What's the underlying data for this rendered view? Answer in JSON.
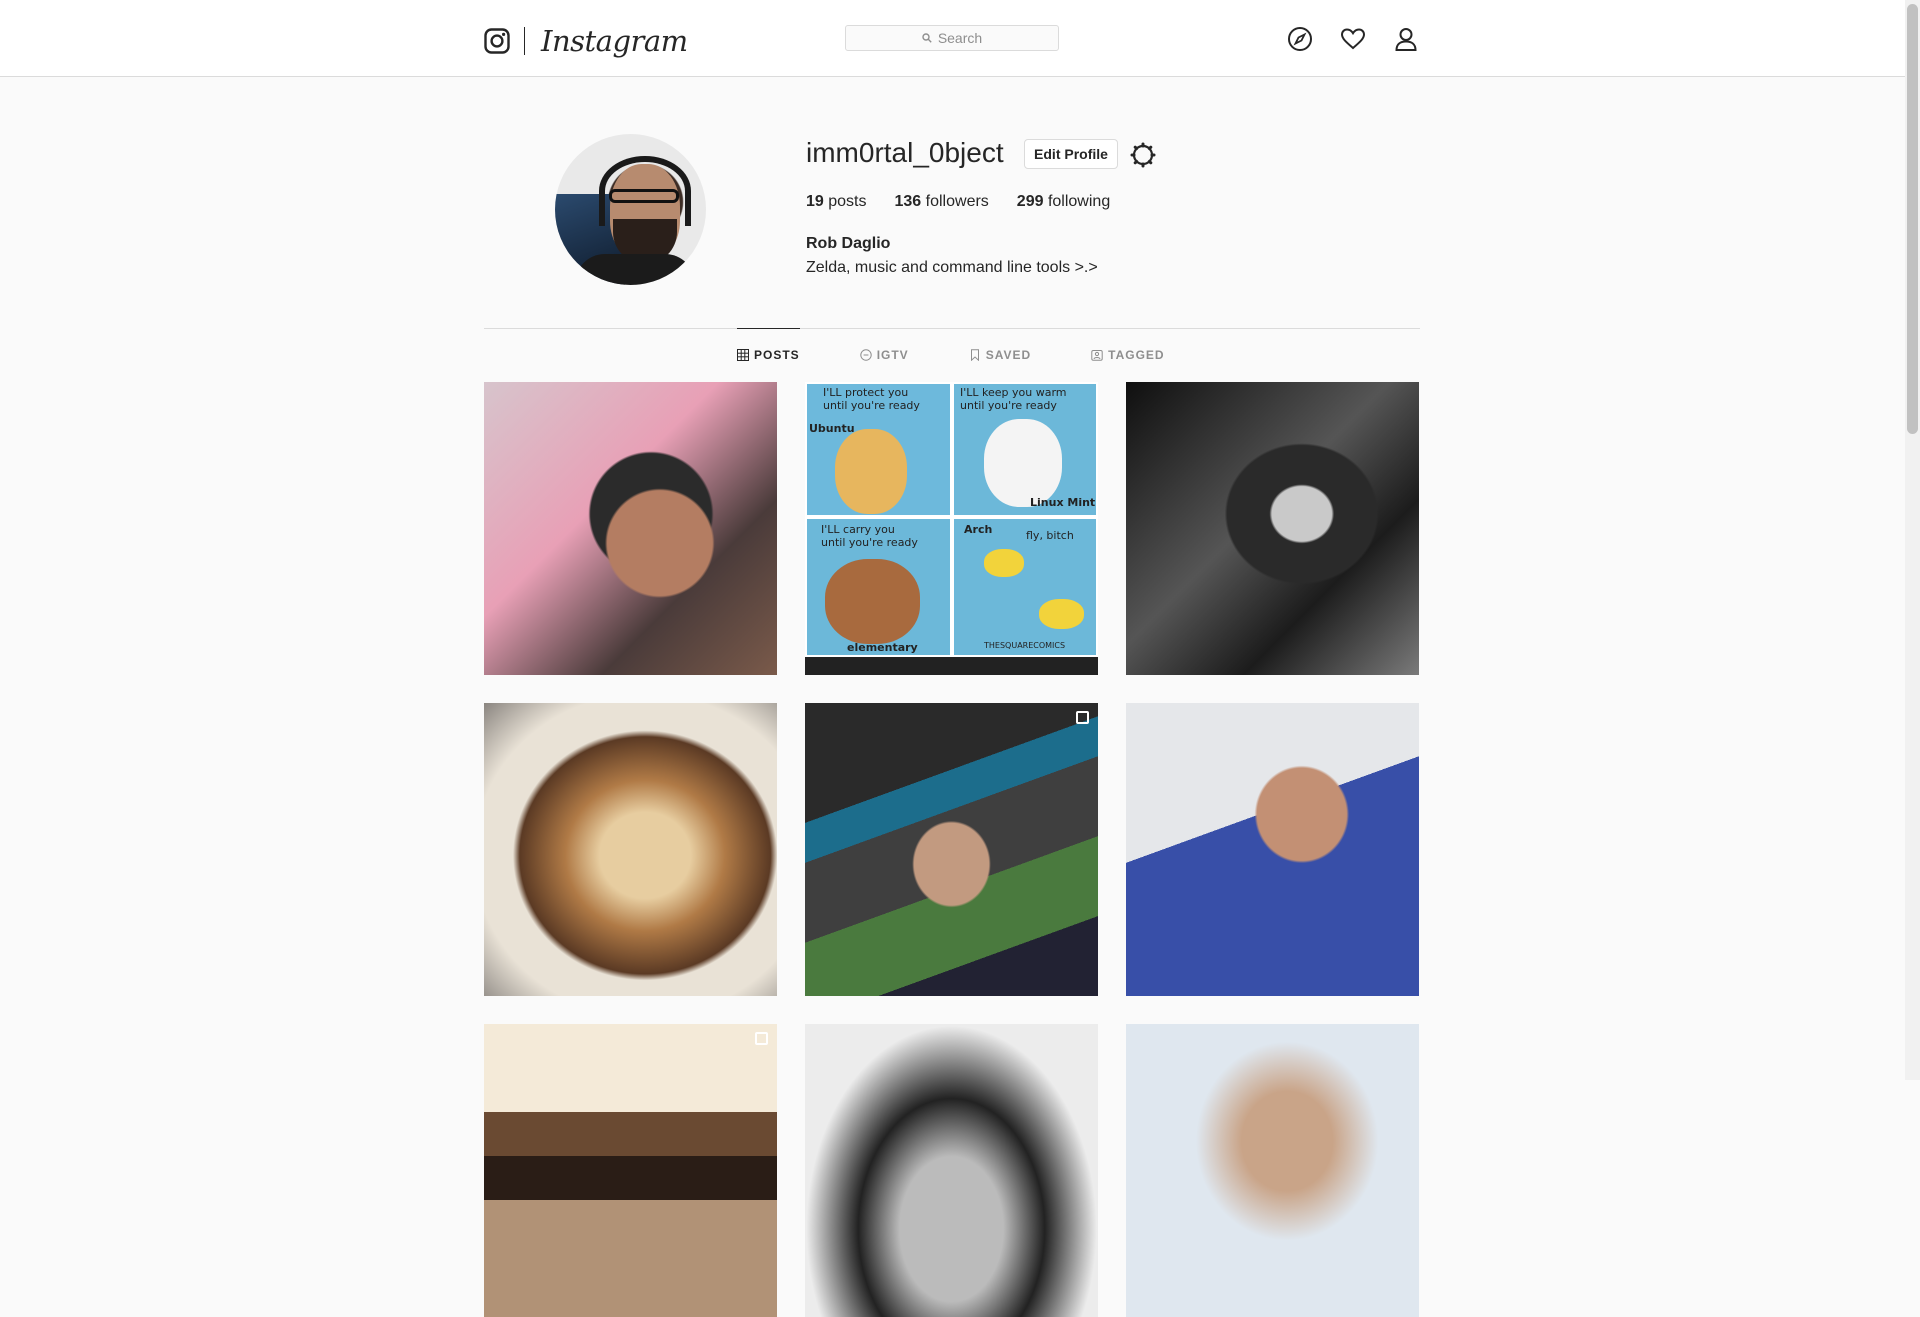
{
  "header": {
    "wordmark": "Instagram",
    "search_placeholder": "Search",
    "icons": [
      "instagram-glyph-icon",
      "search-icon",
      "compass-icon",
      "heart-icon",
      "user-icon"
    ]
  },
  "profile": {
    "username": "imm0rtal_0bject",
    "edit_profile_label": "Edit Profile",
    "stats": {
      "posts_count": "19",
      "posts_label": "posts",
      "followers_count": "136",
      "followers_label": "followers",
      "following_count": "299",
      "following_label": "following"
    },
    "full_name": "Rob Daglio",
    "bio": "Zelda, music and command line tools >.>"
  },
  "tabs": [
    {
      "label": "POSTS",
      "icon": "grid-icon",
      "active": true
    },
    {
      "label": "IGTV",
      "icon": "tv-icon",
      "active": false
    },
    {
      "label": "SAVED",
      "icon": "bookmark-icon",
      "active": false
    },
    {
      "label": "TAGGED",
      "icon": "tag-icon",
      "active": false
    }
  ],
  "comic": {
    "panel1_caption": "I'LL protect you\nuntil you're ready",
    "panel1_label": "Ubuntu",
    "panel2_caption": "I'LL keep you warm\nuntil you're ready",
    "panel2_label": "Linux Mint",
    "panel3_caption": "I'LL carry you\nuntil you're ready",
    "panel3_label": "elementary",
    "panel4_caption": "fly, bitch",
    "panel4_label": "Arch",
    "credit": "THESQUARECOMICS"
  },
  "colors": {
    "link": "#262626",
    "border": "#dbdbdb",
    "muted": "#8e8e8e",
    "background": "#fafafa"
  }
}
